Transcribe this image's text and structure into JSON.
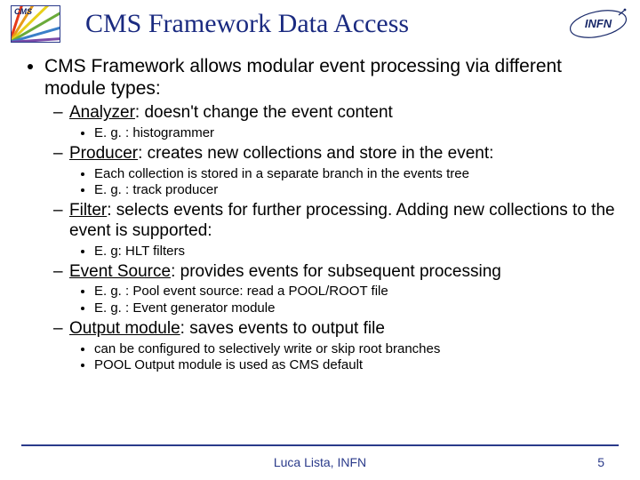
{
  "header": {
    "cms_label": "CMS",
    "title": "CMS Framework Data Access",
    "infn_label": "INFN"
  },
  "bullet_main": "CMS Framework allows modular event processing via different module types:",
  "modules": [
    {
      "name": "Analyzer",
      "desc": ": doesn't change the event content",
      "subs": [
        "E. g. : histogrammer"
      ]
    },
    {
      "name": "Producer",
      "desc": ": creates new collections and store in the event:",
      "subs": [
        "Each collection is stored in a separate branch in the events tree",
        "E. g. : track producer"
      ]
    },
    {
      "name": "Filter",
      "desc": ": selects events for further processing. Adding new collections to the event is supported:",
      "subs": [
        "E. g: HLT filters"
      ]
    },
    {
      "name": "Event Source",
      "desc": ": provides events for subsequent processing",
      "subs": [
        "E. g. : Pool event source: read a POOL/ROOT file",
        "E. g. : Event generator module"
      ]
    },
    {
      "name": "Output module",
      "desc": ": saves events to output file",
      "subs": [
        "can be configured to selectively write or skip root branches",
        "POOL Output module is used as CMS default"
      ]
    }
  ],
  "footer": {
    "author": "Luca Lista, INFN",
    "page": "5"
  }
}
